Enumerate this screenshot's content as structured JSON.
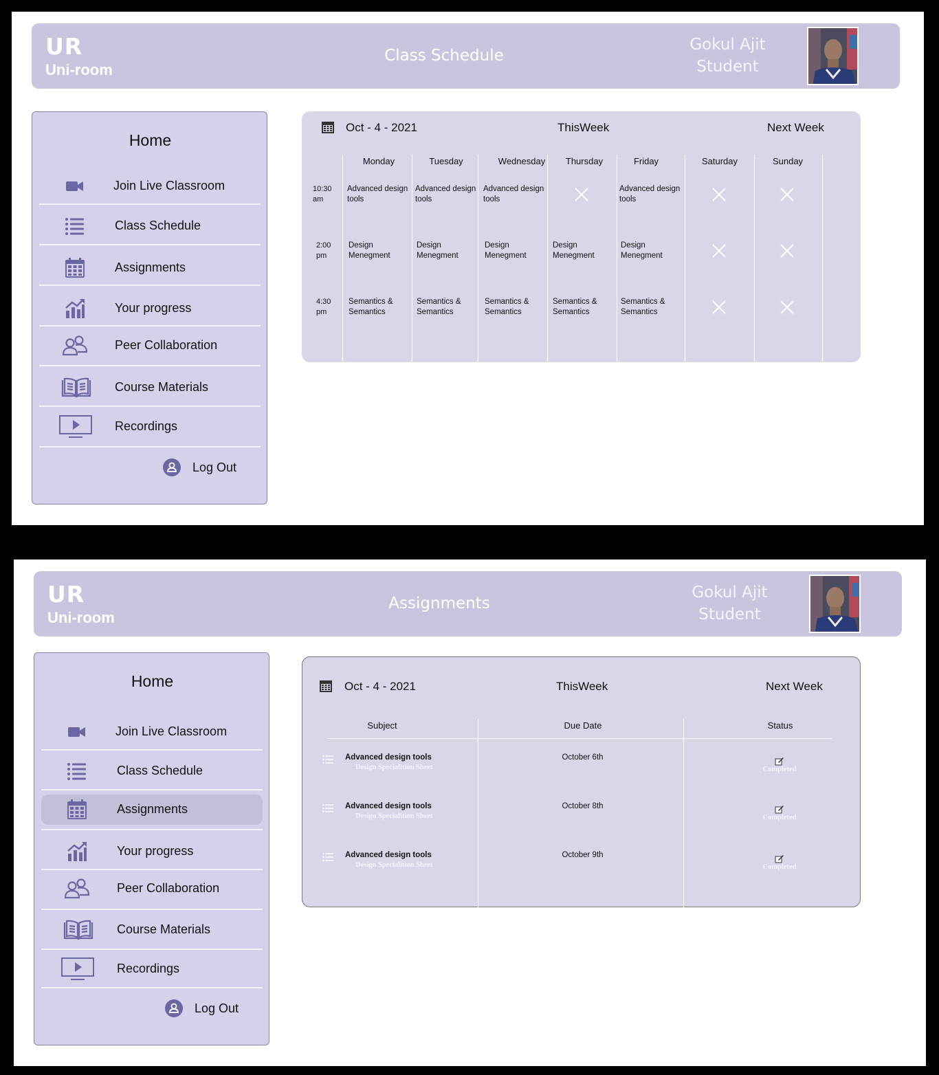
{
  "app": {
    "logo_short": "UR",
    "logo_name": "Uni-room"
  },
  "user": {
    "name": "Gokul Ajit",
    "role": "Student"
  },
  "sidebar": {
    "home": "Home",
    "items": [
      {
        "label": "Join Live Classroom",
        "icon": "video-camera-icon"
      },
      {
        "label": "Class Schedule",
        "icon": "list-icon"
      },
      {
        "label": "Assignments",
        "icon": "calendar-icon"
      },
      {
        "label": "Your progress",
        "icon": "chart-icon"
      },
      {
        "label": "Peer Collaboration",
        "icon": "people-icon"
      },
      {
        "label": "Course Materials",
        "icon": "book-icon"
      },
      {
        "label": "Recordings",
        "icon": "play-screen-icon"
      }
    ],
    "logout": "Log Out"
  },
  "schedule_screen": {
    "title": "Class Schedule",
    "date": "Oct - 4 - 2021",
    "this_week": "ThisWeek",
    "next_week": "Next Week",
    "days": [
      "Monday",
      "Tuesday",
      "Wednesday",
      "Thursday",
      "Friday",
      "Saturday",
      "Sunday"
    ],
    "slots": [
      {
        "time_a": "10:30",
        "time_b": "am",
        "cells": [
          [
            "Advanced design",
            "tools"
          ],
          [
            "Advanced design",
            "tools"
          ],
          [
            "Advanced design",
            "tools"
          ],
          null,
          [
            "Advanced design",
            "tools"
          ],
          null,
          null
        ]
      },
      {
        "time_a": "2:00",
        "time_b": "pm",
        "cells": [
          [
            "Design",
            "Menegment"
          ],
          [
            "Design",
            "Menegment"
          ],
          [
            "Design",
            "Menegment"
          ],
          [
            "Design",
            "Menegment"
          ],
          [
            "Design",
            "Menegment"
          ],
          null,
          null
        ]
      },
      {
        "time_a": "4:30",
        "time_b": "pm",
        "cells": [
          [
            "Semantics &",
            "Semantics"
          ],
          [
            "Semantics &",
            "Semantics"
          ],
          [
            "Semantics &",
            "Semantics"
          ],
          [
            "Semantics &",
            "Semantics"
          ],
          [
            "Semantics &",
            "Semantics"
          ],
          null,
          null
        ]
      }
    ]
  },
  "assignments_screen": {
    "title": "Assignments",
    "date": "Oct - 4 - 2021",
    "this_week": "ThisWeek",
    "next_week": "Next Week",
    "columns": [
      "Subject",
      "Due Date",
      "Status"
    ],
    "rows": [
      {
        "subject": "Advanced design tools",
        "detail": "Design Specialition Sheet",
        "due": "October 6th",
        "status": "Completed"
      },
      {
        "subject": "Advanced design tools",
        "detail": "Design Specialition Sheet",
        "due": "October 8th",
        "status": "Completed"
      },
      {
        "subject": "Advanced design tools",
        "detail": "Design Specialition Sheet",
        "due": "October 9th",
        "status": "Completed"
      }
    ]
  },
  "colors": {
    "header_bg": "#c9c5de",
    "sidebar_bg": "#d5d1ea",
    "panel_bg": "#d9d6e8",
    "icon": "#6b67a3",
    "active_item": "#c3bfd9"
  }
}
